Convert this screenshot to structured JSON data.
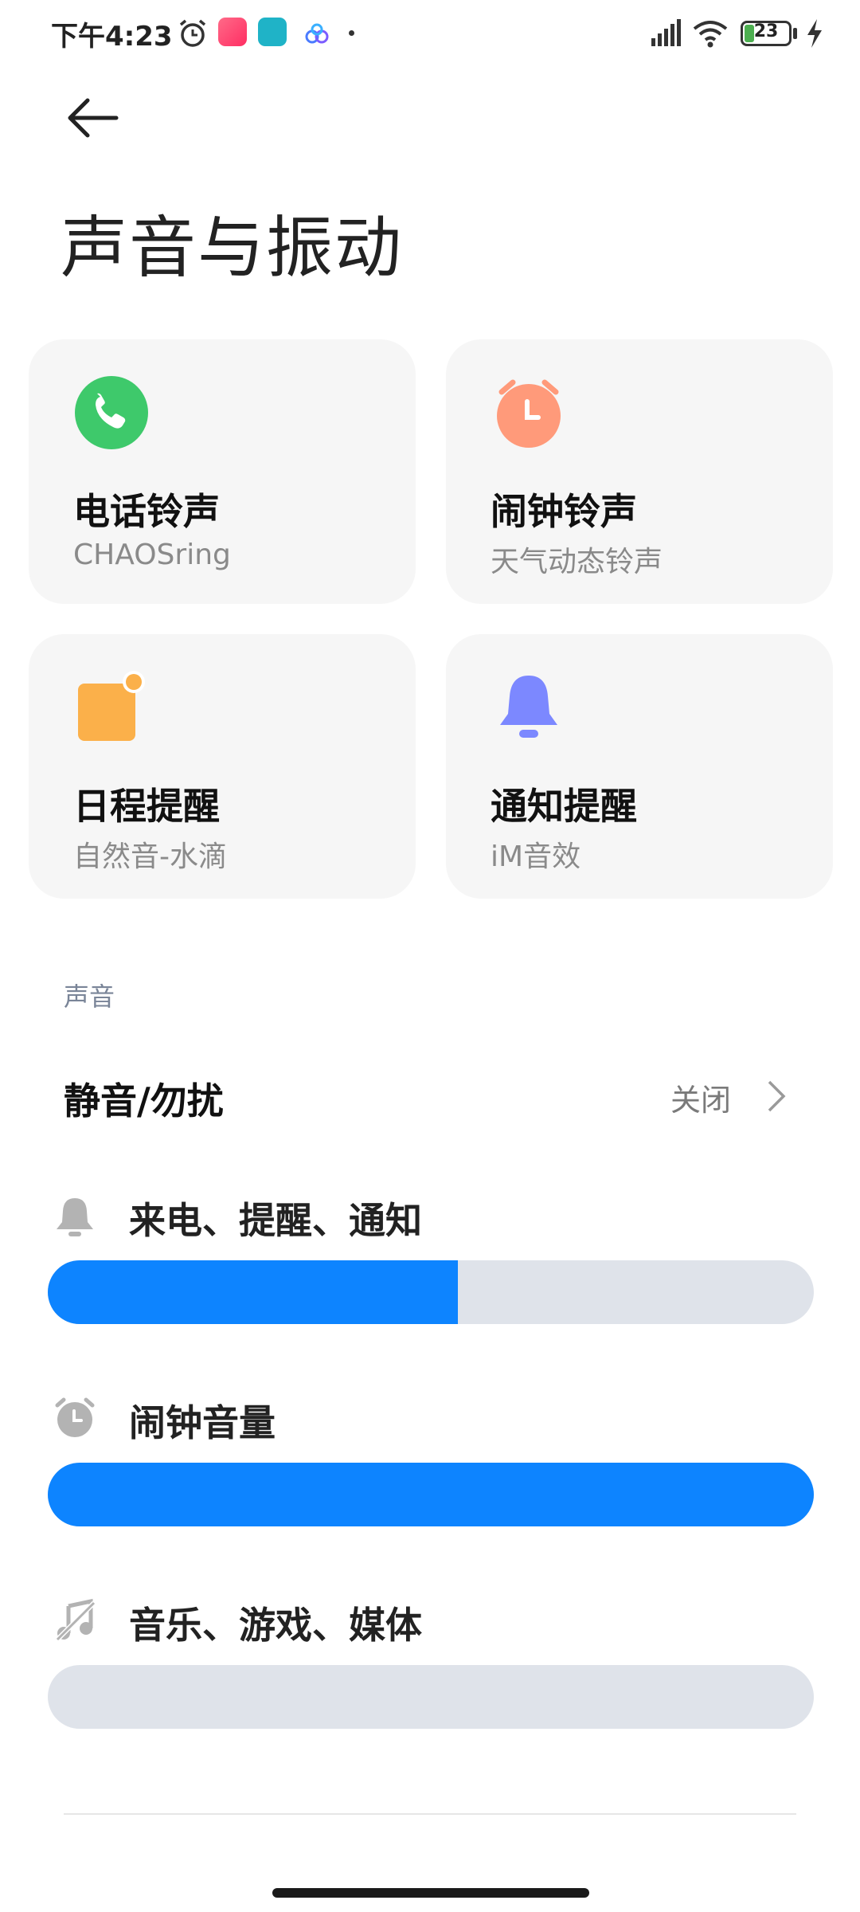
{
  "status_bar": {
    "time": "下午4:23",
    "battery_level": "23",
    "battery_fraction": 0.23
  },
  "header": {
    "title": "声音与振动"
  },
  "cards": [
    {
      "title": "电话铃声",
      "subtitle": "CHAOSring",
      "icon": "phone-icon",
      "color": "#3ec96b"
    },
    {
      "title": "闹钟铃声",
      "subtitle": "天气动态铃声",
      "icon": "alarm-clock-icon",
      "color": "#ff9a7a"
    },
    {
      "title": "日程提醒",
      "subtitle": "自然音-水滴",
      "icon": "calendar-icon",
      "color": "#fbb04a"
    },
    {
      "title": "通知提醒",
      "subtitle": "iM音效",
      "icon": "bell-icon",
      "color": "#7c88ff"
    }
  ],
  "sound_section": {
    "label": "声音",
    "mute": {
      "title": "静音/勿扰",
      "value": "关闭"
    },
    "volumes": [
      {
        "label": "来电、提醒、通知",
        "icon": "bell-icon",
        "level": 0.535
      },
      {
        "label": "闹钟音量",
        "icon": "alarm-clock-icon",
        "level": 1.0
      },
      {
        "label": "音乐、游戏、媒体",
        "icon": "music-muted-icon",
        "level": 0.0
      }
    ]
  },
  "colors": {
    "accent": "#0d84ff",
    "slider_track": "#dfe3ea",
    "card_bg": "#f6f6f6"
  }
}
